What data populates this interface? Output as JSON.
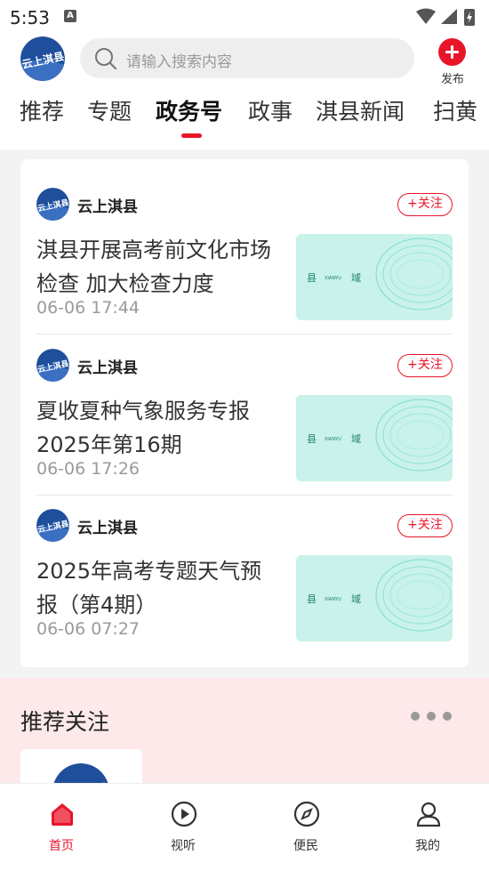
{
  "status": {
    "time": "5:53",
    "badge": "A"
  },
  "header": {
    "logo_text": "云上淇县",
    "search_placeholder": "请输入搜索内容",
    "publish_label": "发布"
  },
  "tabs": [
    {
      "label": "推荐"
    },
    {
      "label": "专题"
    },
    {
      "label": "政务号"
    },
    {
      "label": "政事"
    },
    {
      "label": "淇县新闻"
    },
    {
      "label": "扫黄"
    }
  ],
  "feed": [
    {
      "source": "云上淇县",
      "follow": "+关注",
      "title": "淇县开展高考前文化市场检查 加大检查力度",
      "time": "06-06 17:44",
      "thumb_left": "县",
      "thumb_mid": "XIANYU",
      "thumb_right": "域"
    },
    {
      "source": "云上淇县",
      "follow": "+关注",
      "title": "夏收夏种气象服务专报2025年第16期",
      "time": "06-06 17:26",
      "thumb_left": "县",
      "thumb_mid": "XIANYU",
      "thumb_right": "域"
    },
    {
      "source": "云上淇县",
      "follow": "+关注",
      "title": "2025年高考专题天气预报（第4期）",
      "time": "06-06 07:27",
      "thumb_left": "县",
      "thumb_mid": "XIANYU",
      "thumb_right": "域"
    }
  ],
  "recommend": {
    "title": "推荐关注"
  },
  "bottom_nav": [
    {
      "label": "首页",
      "icon": "home-icon"
    },
    {
      "label": "视听",
      "icon": "play-icon"
    },
    {
      "label": "便民",
      "icon": "compass-icon"
    },
    {
      "label": "我的",
      "icon": "user-icon"
    }
  ],
  "colors": {
    "accent": "#e8152a",
    "logo_blue": "#1f4f9c",
    "thumb_teal": "#bff0e6"
  }
}
